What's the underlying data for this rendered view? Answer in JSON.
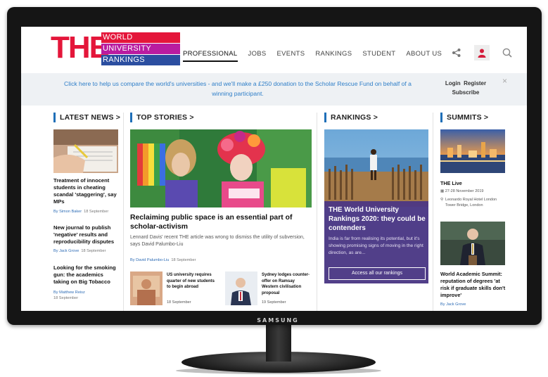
{
  "device": {
    "brand": "SAMSUNG"
  },
  "logo": {
    "main": "THE",
    "line1": "WORLD",
    "line2": "UNIVERSITY",
    "line3": "RANKINGS"
  },
  "nav": {
    "items": [
      "PROFESSIONAL",
      "JOBS",
      "EVENTS",
      "RANKINGS",
      "STUDENT",
      "ABOUT US"
    ]
  },
  "banner": {
    "text": "Click here to help us compare the world's universities - and we'll make a £250 donation to the Scholar Rescue Fund on behalf of a winning participant.",
    "login": "Login",
    "register": "Register",
    "subscribe": "Subscribe",
    "close": "×"
  },
  "latest_news": {
    "heading": "LATEST NEWS >",
    "items": [
      {
        "title": "Treatment of innocent students in cheating scandal 'staggering', say MPs",
        "author": "By Simon Baker",
        "date": "18 September"
      },
      {
        "title": "New journal to publish 'negative' results and reproducibility disputes",
        "author": "By Jack Grove",
        "date": "18 September"
      },
      {
        "title": "Looking for the smoking gun: the academics taking on Big Tobacco",
        "author": "By Matthew Reisz",
        "date": "18 September"
      }
    ]
  },
  "top_stories": {
    "heading": "TOP STORIES >",
    "main": {
      "title": "Reclaiming public space is an essential part of scholar-activism",
      "summary": "Lennard Davis' recent THE article was wrong to dismiss the utility of subversion, says David Palumbo-Liu",
      "author": "By David Palumbo-Liu",
      "date": "18 September"
    },
    "small": [
      {
        "title": "US university requires quarter of new students to begin abroad",
        "date": "18 September"
      },
      {
        "title": "Sydney lodges counter-offer on Ramsay Western civilisation proposal",
        "date": "19 September"
      }
    ]
  },
  "rankings": {
    "heading": "RANKINGS >",
    "title": "THE World University Rankings 2020: they could be contenders",
    "summary": "India is far from realising its potential, but it's showing promising signs of moving in the right direction, as are...",
    "button": "Access all our rankings"
  },
  "summits": {
    "heading": "SUMMITS >",
    "event": {
      "title": "THE Live",
      "date": "27-28 November 2019",
      "location": "Leonardo Royal Hotel London Tower Bridge, London"
    },
    "story": {
      "title": "World Academic Summit: reputation of degrees 'at risk if graduate skills don't improve'",
      "author": "By Jack Grove"
    }
  },
  "colors": {
    "accent": "#e4163a",
    "link": "#2e7ec8",
    "rank_panel": "#4c3784"
  }
}
